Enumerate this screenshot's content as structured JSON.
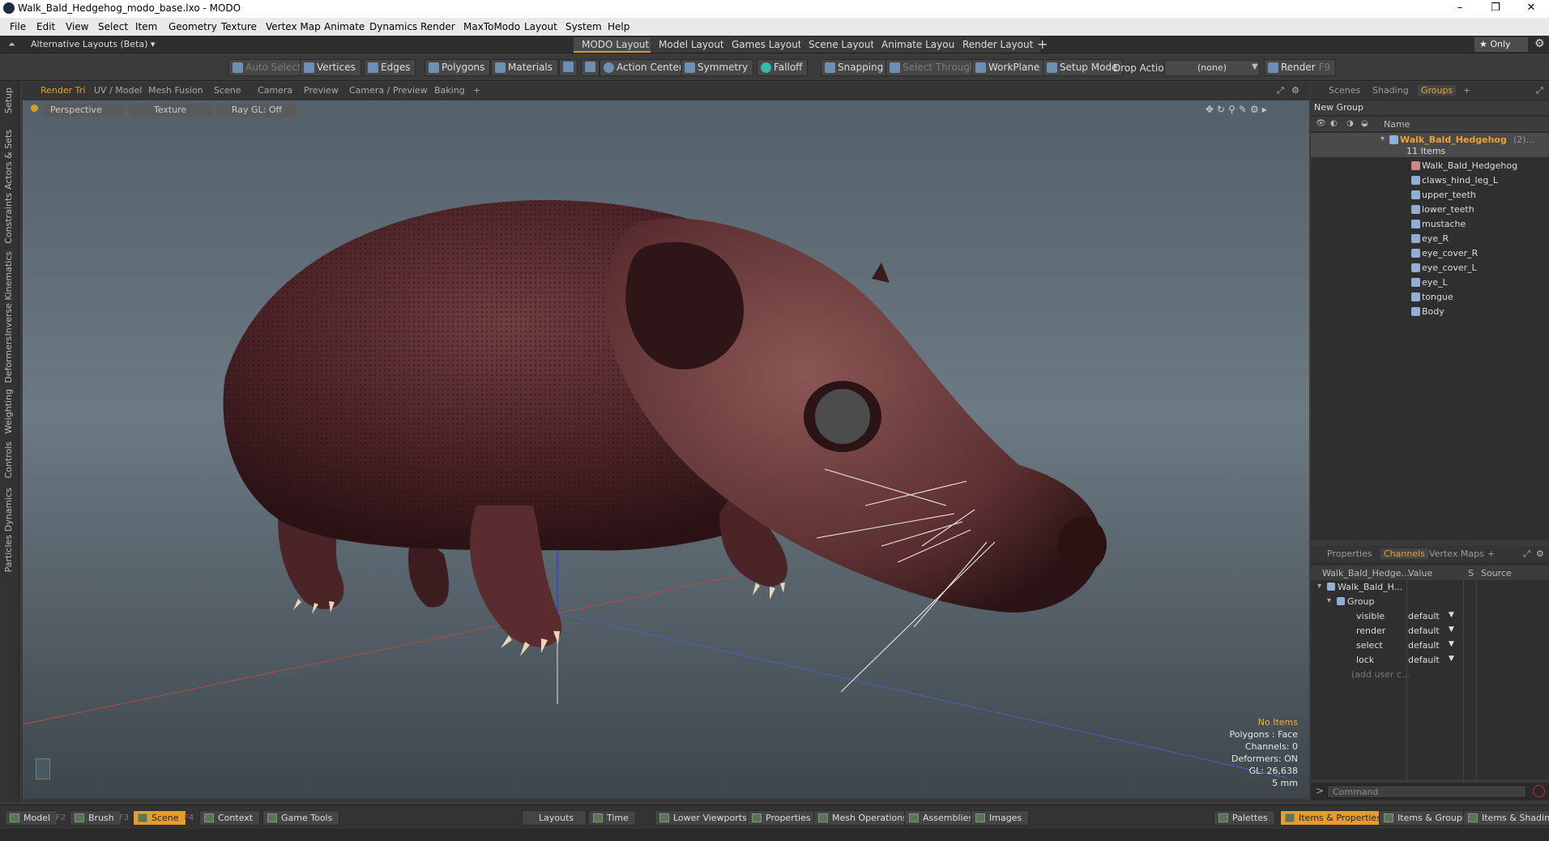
{
  "window": {
    "title": "Walk_Bald_Hedgehog_modo_base.lxo - MODO",
    "min": "–",
    "max": "❐",
    "close": "✕"
  },
  "menu": [
    "File",
    "Edit",
    "View",
    "Select",
    "Item",
    "Geometry",
    "Texture",
    "Vertex Map",
    "Animate",
    "Dynamics",
    "Render",
    "MaxToModo",
    "Layout",
    "System",
    "Help"
  ],
  "layouts": {
    "dropdown": "Alternative Layouts (Beta) ▾",
    "tabs": [
      "MODO Layout",
      "Model Layout",
      "Games Layout",
      "Scene Layout",
      "Animate Layout",
      "Render Layout"
    ],
    "active": "MODO Layout",
    "add": "+",
    "only": "★ Only"
  },
  "toolbar": {
    "auto_select": "Auto Select",
    "vertices": "Vertices",
    "edges": "Edges",
    "polygons": "Polygons",
    "materials": "Materials",
    "action_center": "Action Center",
    "symmetry": "Symmetry",
    "falloff": "Falloff",
    "snapping": "Snapping",
    "select_through": "Select Through",
    "workplane": "WorkPlane",
    "setup_mode": "Setup Mode",
    "drop_action_label": "Drop Action",
    "drop_action_value": "(none)",
    "render": "Render",
    "render_key": "F9"
  },
  "left_strip": [
    "Setup",
    "Actors & Sets",
    "Constraints",
    "Inverse Kinematics",
    "Deformers",
    "Weighting",
    "Controls",
    "Dynamics",
    "Particles"
  ],
  "viewport": {
    "tabs": [
      "Render Tri",
      "UV / Model",
      "Mesh Fusion",
      "Scene",
      "Camera",
      "Preview",
      "Camera / Preview",
      "Baking",
      "+"
    ],
    "active_tab": "Render Tri",
    "view_mode": "Perspective",
    "shading": "Texture",
    "raygl": "Ray GL: Off",
    "hud": {
      "items": "No Items",
      "polygons": "Polygons : Face",
      "channels": "Channels: 0",
      "deformers": "Deformers: ON",
      "gl": "GL: 26,638",
      "unit": "5 mm"
    }
  },
  "groups_panel": {
    "tabs": [
      "Scenes",
      "Shading",
      "Groups",
      "+"
    ],
    "active_tab": "Groups",
    "new_group": "New Group",
    "name_header": "Name",
    "root": {
      "name": "Walk_Bald_Hedgehog",
      "suffix": "(2)...",
      "count": "11 Items"
    },
    "items": [
      "Walk_Bald_Hedgehog",
      "claws_hind_leg_L",
      "upper_teeth",
      "lower_teeth",
      "mustache",
      "eye_R",
      "eye_cover_R",
      "eye_cover_L",
      "eye_L",
      "tongue",
      "Body"
    ]
  },
  "props_panel": {
    "tabs": [
      "Properties",
      "Channels",
      "Vertex Maps",
      "+"
    ],
    "active_tab": "Channels",
    "header": {
      "item": "Walk_Bald_Hedge...",
      "value": "Value",
      "s": "S",
      "source": "Source"
    },
    "root": "Walk_Bald_H...",
    "group": "Group",
    "channels": [
      {
        "name": "visible",
        "value": "default"
      },
      {
        "name": "render",
        "value": "default"
      },
      {
        "name": "select",
        "value": "default"
      },
      {
        "name": "lock",
        "value": "default"
      }
    ],
    "add_user": "(add user c..."
  },
  "command": {
    "placeholder": "Command",
    "prompt": ">"
  },
  "bottom": {
    "left": [
      {
        "label": "Model",
        "key": "F2"
      },
      {
        "label": "Brush",
        "key": "F3"
      },
      {
        "label": "Scene",
        "key": "F4"
      },
      {
        "label": "Context",
        "key": ""
      },
      {
        "label": "Game Tools",
        "key": ""
      }
    ],
    "active_left": "Scene",
    "center": [
      "Layouts",
      "Time",
      "Lower Viewports",
      "Properties",
      "Mesh Operations",
      "Assemblies",
      "Images"
    ],
    "right": [
      "Palettes",
      "Items & Properties",
      "Items & Groups",
      "Items & Shading"
    ],
    "active_right": "Items & Properties"
  },
  "colors": {
    "accent": "#e2a437",
    "active_button": "#e79d2a"
  }
}
